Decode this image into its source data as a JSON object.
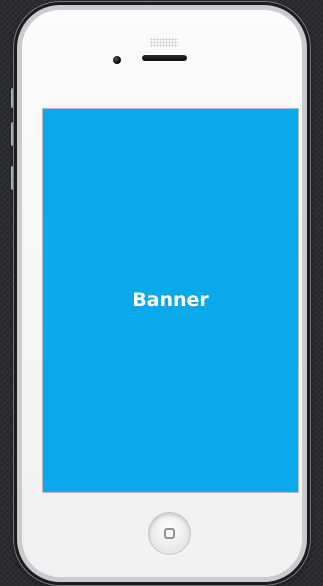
{
  "screen": {
    "banner_label": "Banner",
    "background_color": "#0aa9ea",
    "text_color": "#ffffff"
  },
  "device": {
    "body_color": "#f5f5f5",
    "bezel_color": "#1b1c1e"
  },
  "icons": {
    "home": "home-button-square-icon",
    "camera": "front-camera-icon",
    "speaker": "earpiece-speaker-icon"
  }
}
